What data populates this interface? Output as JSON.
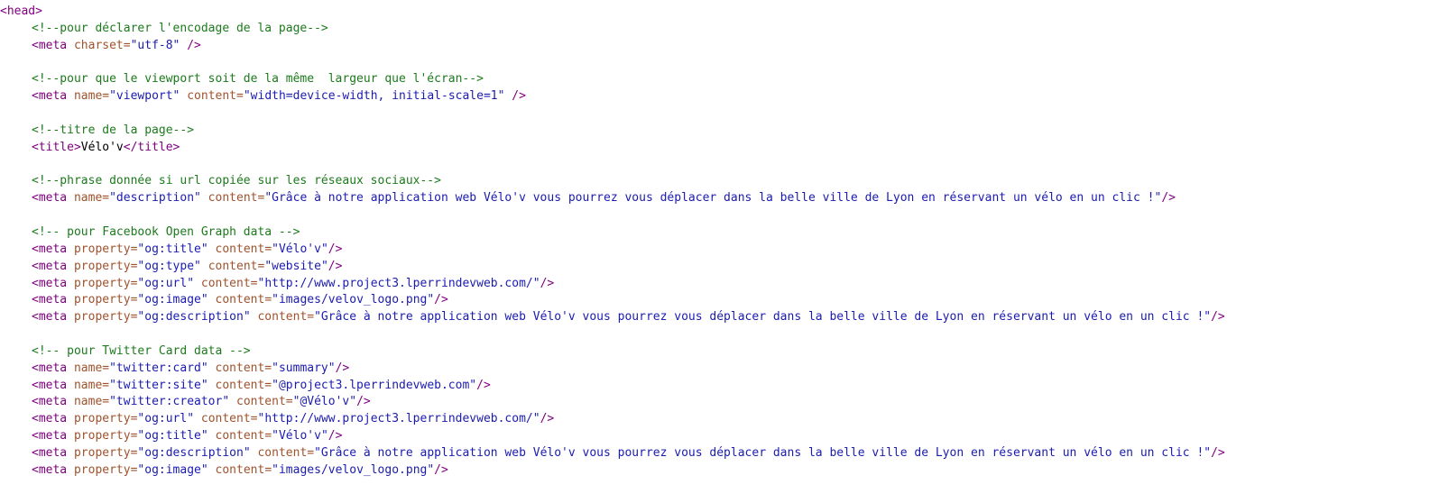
{
  "colors": {
    "background": "#ffffff",
    "tag": "#800080",
    "attribute": "#a0522d",
    "value": "#1b1bb0",
    "comment": "#1c7a1c",
    "text": "#000000"
  },
  "lines": [
    {
      "indent": 0,
      "tokens": [
        {
          "t": "tag",
          "v": "<head>"
        }
      ]
    },
    {
      "indent": 1,
      "tokens": [
        {
          "t": "comment",
          "v": "<!--pour déclarer l'encodage de la page-->"
        }
      ]
    },
    {
      "indent": 1,
      "tokens": [
        {
          "t": "tag",
          "v": "<meta "
        },
        {
          "t": "attr",
          "v": "charset="
        },
        {
          "t": "value",
          "v": "\"utf-8\""
        },
        {
          "t": "tag",
          "v": " />"
        }
      ]
    },
    {
      "indent": 0,
      "tokens": []
    },
    {
      "indent": 1,
      "tokens": [
        {
          "t": "comment",
          "v": "<!--pour que le viewport soit de la même  largeur que l'écran-->"
        }
      ]
    },
    {
      "indent": 1,
      "tokens": [
        {
          "t": "tag",
          "v": "<meta "
        },
        {
          "t": "attr",
          "v": "name="
        },
        {
          "t": "value",
          "v": "\"viewport\""
        },
        {
          "t": "attr",
          "v": " content="
        },
        {
          "t": "value",
          "v": "\"width=device-width, initial-scale=1\""
        },
        {
          "t": "tag",
          "v": " />"
        }
      ]
    },
    {
      "indent": 0,
      "tokens": []
    },
    {
      "indent": 1,
      "tokens": [
        {
          "t": "comment",
          "v": "<!--titre de la page-->"
        }
      ]
    },
    {
      "indent": 1,
      "tokens": [
        {
          "t": "tag",
          "v": "<title>"
        },
        {
          "t": "text",
          "v": "Vélo'v"
        },
        {
          "t": "tag",
          "v": "</title>"
        }
      ]
    },
    {
      "indent": 0,
      "tokens": []
    },
    {
      "indent": 1,
      "tokens": [
        {
          "t": "comment",
          "v": "<!--phrase donnée si url copiée sur les réseaux sociaux-->"
        }
      ]
    },
    {
      "indent": 1,
      "tokens": [
        {
          "t": "tag",
          "v": "<meta "
        },
        {
          "t": "attr",
          "v": "name="
        },
        {
          "t": "value",
          "v": "\"description\""
        },
        {
          "t": "attr",
          "v": " content="
        },
        {
          "t": "value",
          "v": "\"Grâce à notre application web Vélo'v vous pourrez vous déplacer dans la belle ville de Lyon en réservant un vélo en un clic !\""
        },
        {
          "t": "tag",
          "v": "/>"
        }
      ]
    },
    {
      "indent": 0,
      "tokens": []
    },
    {
      "indent": 1,
      "tokens": [
        {
          "t": "comment",
          "v": "<!-- pour Facebook Open Graph data -->"
        }
      ]
    },
    {
      "indent": 1,
      "tokens": [
        {
          "t": "tag",
          "v": "<meta "
        },
        {
          "t": "attr",
          "v": "property="
        },
        {
          "t": "value",
          "v": "\"og:title\""
        },
        {
          "t": "attr",
          "v": " content="
        },
        {
          "t": "value",
          "v": "\"Vélo'v\""
        },
        {
          "t": "tag",
          "v": "/>"
        }
      ]
    },
    {
      "indent": 1,
      "tokens": [
        {
          "t": "tag",
          "v": "<meta "
        },
        {
          "t": "attr",
          "v": "property="
        },
        {
          "t": "value",
          "v": "\"og:type\""
        },
        {
          "t": "attr",
          "v": " content="
        },
        {
          "t": "value",
          "v": "\"website\""
        },
        {
          "t": "tag",
          "v": "/>"
        }
      ]
    },
    {
      "indent": 1,
      "tokens": [
        {
          "t": "tag",
          "v": "<meta "
        },
        {
          "t": "attr",
          "v": "property="
        },
        {
          "t": "value",
          "v": "\"og:url\""
        },
        {
          "t": "attr",
          "v": " content="
        },
        {
          "t": "value",
          "v": "\"http://www.project3.lperrindevweb.com/\""
        },
        {
          "t": "tag",
          "v": "/>"
        }
      ]
    },
    {
      "indent": 1,
      "tokens": [
        {
          "t": "tag",
          "v": "<meta "
        },
        {
          "t": "attr",
          "v": "property="
        },
        {
          "t": "value",
          "v": "\"og:image\""
        },
        {
          "t": "attr",
          "v": " content="
        },
        {
          "t": "value",
          "v": "\"images/velov_logo.png\""
        },
        {
          "t": "tag",
          "v": "/>"
        }
      ]
    },
    {
      "indent": 1,
      "tokens": [
        {
          "t": "tag",
          "v": "<meta "
        },
        {
          "t": "attr",
          "v": "property="
        },
        {
          "t": "value",
          "v": "\"og:description\""
        },
        {
          "t": "attr",
          "v": " content="
        },
        {
          "t": "value",
          "v": "\"Grâce à notre application web Vélo'v vous pourrez vous déplacer dans la belle ville de Lyon en réservant un vélo en un clic !\""
        },
        {
          "t": "tag",
          "v": "/>"
        }
      ]
    },
    {
      "indent": 0,
      "tokens": []
    },
    {
      "indent": 1,
      "tokens": [
        {
          "t": "comment",
          "v": "<!-- pour Twitter Card data -->"
        }
      ]
    },
    {
      "indent": 1,
      "tokens": [
        {
          "t": "tag",
          "v": "<meta "
        },
        {
          "t": "attr",
          "v": "name="
        },
        {
          "t": "value",
          "v": "\"twitter:card\""
        },
        {
          "t": "attr",
          "v": " content="
        },
        {
          "t": "value",
          "v": "\"summary\""
        },
        {
          "t": "tag",
          "v": "/>"
        }
      ]
    },
    {
      "indent": 1,
      "tokens": [
        {
          "t": "tag",
          "v": "<meta "
        },
        {
          "t": "attr",
          "v": "name="
        },
        {
          "t": "value",
          "v": "\"twitter:site\""
        },
        {
          "t": "attr",
          "v": " content="
        },
        {
          "t": "value",
          "v": "\"@project3.lperrindevweb.com\""
        },
        {
          "t": "tag",
          "v": "/>"
        }
      ]
    },
    {
      "indent": 1,
      "tokens": [
        {
          "t": "tag",
          "v": "<meta "
        },
        {
          "t": "attr",
          "v": "name="
        },
        {
          "t": "value",
          "v": "\"twitter:creator\""
        },
        {
          "t": "attr",
          "v": " content="
        },
        {
          "t": "value",
          "v": "\"@Vélo'v\""
        },
        {
          "t": "tag",
          "v": "/>"
        }
      ]
    },
    {
      "indent": 1,
      "tokens": [
        {
          "t": "tag",
          "v": "<meta "
        },
        {
          "t": "attr",
          "v": "property="
        },
        {
          "t": "value",
          "v": "\"og:url\""
        },
        {
          "t": "attr",
          "v": " content="
        },
        {
          "t": "value",
          "v": "\"http://www.project3.lperrindevweb.com/\""
        },
        {
          "t": "tag",
          "v": "/>"
        }
      ]
    },
    {
      "indent": 1,
      "tokens": [
        {
          "t": "tag",
          "v": "<meta "
        },
        {
          "t": "attr",
          "v": "property="
        },
        {
          "t": "value",
          "v": "\"og:title\""
        },
        {
          "t": "attr",
          "v": " content="
        },
        {
          "t": "value",
          "v": "\"Vélo'v\""
        },
        {
          "t": "tag",
          "v": "/>"
        }
      ]
    },
    {
      "indent": 1,
      "tokens": [
        {
          "t": "tag",
          "v": "<meta "
        },
        {
          "t": "attr",
          "v": "property="
        },
        {
          "t": "value",
          "v": "\"og:description\""
        },
        {
          "t": "attr",
          "v": " content="
        },
        {
          "t": "value",
          "v": "\"Grâce à notre application web Vélo'v vous pourrez vous déplacer dans la belle ville de Lyon en réservant un vélo en un clic !\""
        },
        {
          "t": "tag",
          "v": "/>"
        }
      ]
    },
    {
      "indent": 1,
      "tokens": [
        {
          "t": "tag",
          "v": "<meta "
        },
        {
          "t": "attr",
          "v": "property="
        },
        {
          "t": "value",
          "v": "\"og:image\""
        },
        {
          "t": "attr",
          "v": " content="
        },
        {
          "t": "value",
          "v": "\"images/velov_logo.png\""
        },
        {
          "t": "tag",
          "v": "/>"
        }
      ]
    }
  ]
}
